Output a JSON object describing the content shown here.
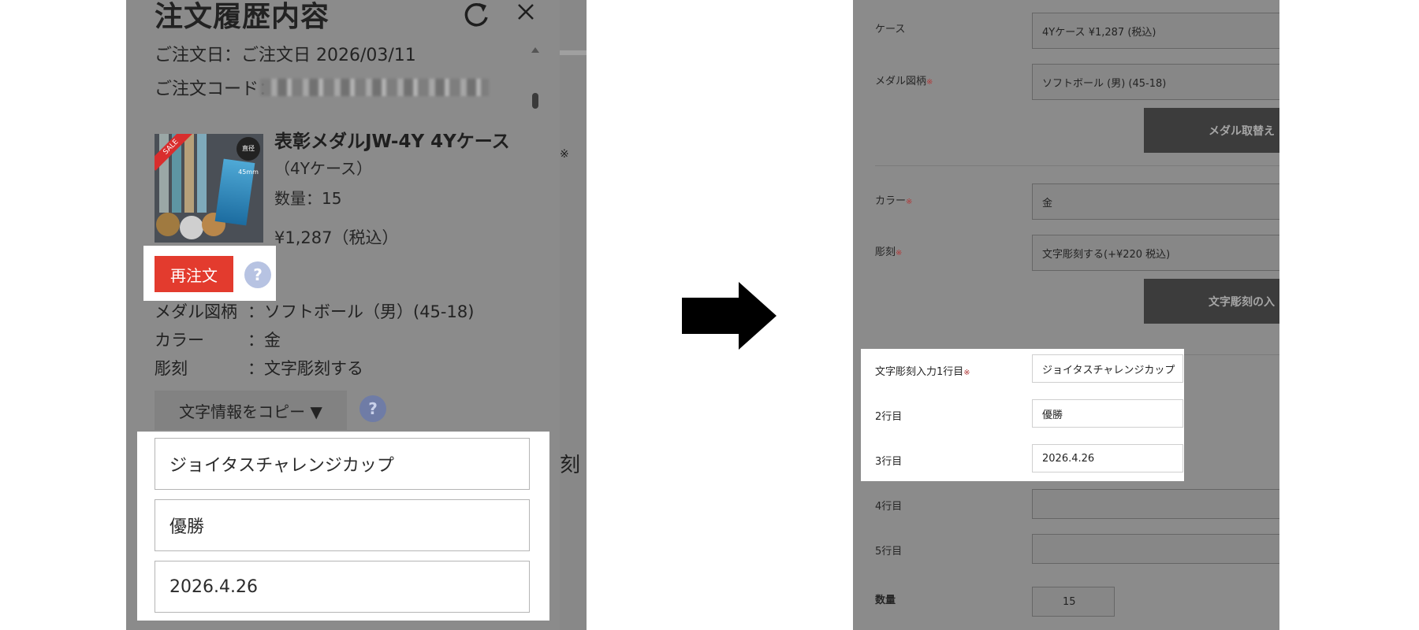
{
  "left": {
    "title": "注文履歴内容",
    "order_date": "ご注文日：ご注文日 2026/03/11",
    "order_code_label": "ご注文コード：",
    "product": {
      "name": "表彰メダルJW-4Y 4Yケース",
      "variant": "（4Yケース）",
      "quantity": "数量：15",
      "price": "¥1,287（税込）",
      "image_badge_sale": "SALE",
      "image_badge_count": "直径 45mm"
    },
    "reorder_label": "再注文",
    "help_mark": "?",
    "options": [
      {
        "key": "メダル図柄",
        "value": "：ソフトボール（男）(45-18)"
      },
      {
        "key": "カラー",
        "value": "：金"
      },
      {
        "key": "彫刻",
        "value": "：文字彫刻する"
      }
    ],
    "copy_button_label": "文字情報をコピー ▼",
    "text_fields": [
      "ジョイタスチャレンジカップ",
      "優勝",
      "2026.4.26"
    ],
    "side_glyph_top": "※",
    "side_glyph_bottom": "刻"
  },
  "right": {
    "rows": [
      {
        "label": "ケース",
        "required": false,
        "value": "4Yケース ¥1,287 (税込)"
      },
      {
        "label": "メダル図柄",
        "required": true,
        "value": "ソフトボール (男) (45-18)"
      },
      {
        "label": "カラー",
        "required": true,
        "value": "金"
      },
      {
        "label": "彫刻",
        "required": true,
        "value": "文字彫刻する(+¥220 税込)"
      }
    ],
    "medal_replace_button": "メダル取替え",
    "engrave_button": "文字彫刻の入",
    "required_mark": "※",
    "engrave_lines": [
      {
        "label": "文字彫刻入力1行目",
        "required": true,
        "value": "ジョイタスチャレンジカップ"
      },
      {
        "label": "2行目",
        "required": false,
        "value": "優勝"
      },
      {
        "label": "3行目",
        "required": false,
        "value": "2026.4.26"
      },
      {
        "label": "4行目",
        "required": false,
        "value": ""
      },
      {
        "label": "5行目",
        "required": false,
        "value": ""
      }
    ],
    "quantity_label": "数量",
    "quantity_value": "15"
  },
  "colors": {
    "overlay_gray": "#8b8b8b",
    "reorder_red": "#e33b2e",
    "help_blue": "#b7c3e2",
    "dark_button": "#3c3c3c",
    "arrow": "#000000"
  },
  "icons": [
    "refresh-icon",
    "close-icon",
    "help-icon",
    "right-arrow-icon"
  ]
}
